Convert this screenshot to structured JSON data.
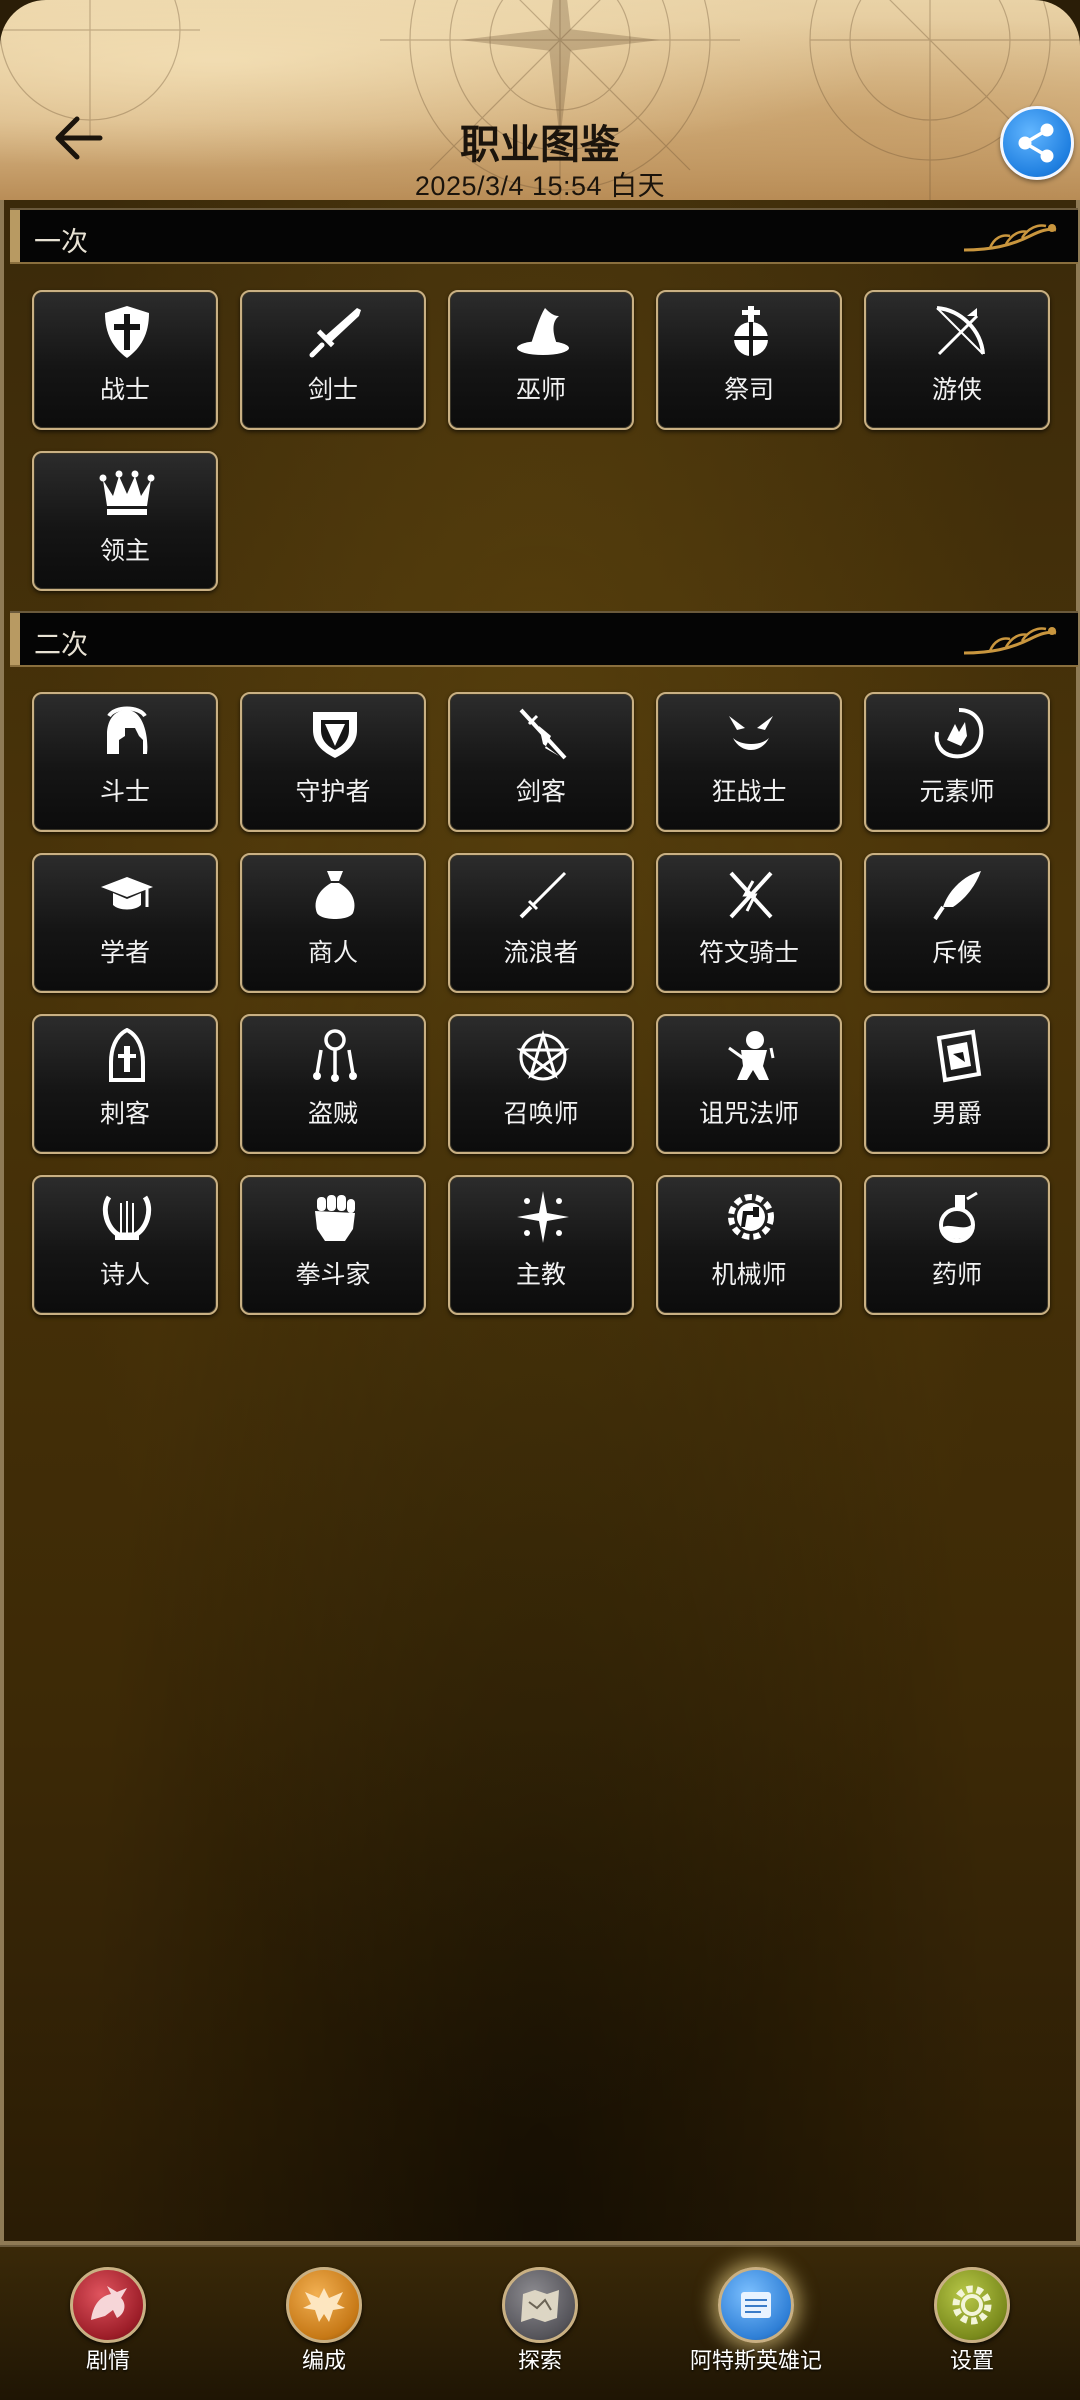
{
  "header": {
    "title": "职业图鉴",
    "subtitle": "2025/3/4 15:54 白天",
    "back_icon": "arrow-left-icon",
    "share_icon": "share-icon",
    "share_color": "#2a8bf0"
  },
  "sections": [
    {
      "label": "一次",
      "jobs": [
        {
          "name": "战士",
          "icon": "cross-shield-icon"
        },
        {
          "name": "剑士",
          "icon": "sword-icon"
        },
        {
          "name": "巫师",
          "icon": "wizard-hat-icon"
        },
        {
          "name": "祭司",
          "icon": "orb-cross-icon"
        },
        {
          "name": "游侠",
          "icon": "bow-arrow-icon"
        },
        {
          "name": "领主",
          "icon": "crown-icon"
        }
      ]
    },
    {
      "label": "二次",
      "jobs": [
        {
          "name": "斗士",
          "icon": "spartan-helmet-icon"
        },
        {
          "name": "守护者",
          "icon": "guardian-shield-icon"
        },
        {
          "name": "剑客",
          "icon": "crossed-blades-icon"
        },
        {
          "name": "狂战士",
          "icon": "berserk-mask-icon"
        },
        {
          "name": "元素师",
          "icon": "elemental-hand-icon"
        },
        {
          "name": "学者",
          "icon": "graduation-cap-icon"
        },
        {
          "name": "商人",
          "icon": "money-bag-icon"
        },
        {
          "name": "流浪者",
          "icon": "katana-icon"
        },
        {
          "name": "符文骑士",
          "icon": "rune-sword-icon"
        },
        {
          "name": "斥候",
          "icon": "feather-knife-icon"
        },
        {
          "name": "刺客",
          "icon": "hooded-assassin-icon"
        },
        {
          "name": "盗贼",
          "icon": "key-ring-icon"
        },
        {
          "name": "召唤师",
          "icon": "pentagram-icon"
        },
        {
          "name": "诅咒法师",
          "icon": "voodoo-doll-icon"
        },
        {
          "name": "男爵",
          "icon": "framed-emblem-icon"
        },
        {
          "name": "诗人",
          "icon": "lyre-icon"
        },
        {
          "name": "拳斗家",
          "icon": "fist-icon"
        },
        {
          "name": "主教",
          "icon": "holy-star-icon"
        },
        {
          "name": "机械师",
          "icon": "gear-hammer-icon"
        },
        {
          "name": "药师",
          "icon": "potion-flask-icon"
        }
      ]
    }
  ],
  "nav": [
    {
      "label": "剧情",
      "icon": "dragon-icon",
      "color": "#b42a35",
      "active": false
    },
    {
      "label": "编成",
      "icon": "eagle-emblem-icon",
      "color": "#d4892a",
      "active": false
    },
    {
      "label": "探索",
      "icon": "map-scroll-icon",
      "color": "#6b6a6e",
      "active": false
    },
    {
      "label": "阿特斯英雄记",
      "icon": "scroll-icon",
      "color": "#3f8ad8",
      "active": true
    },
    {
      "label": "设置",
      "icon": "gear-icon",
      "color": "#8a9a2a",
      "active": false
    }
  ]
}
